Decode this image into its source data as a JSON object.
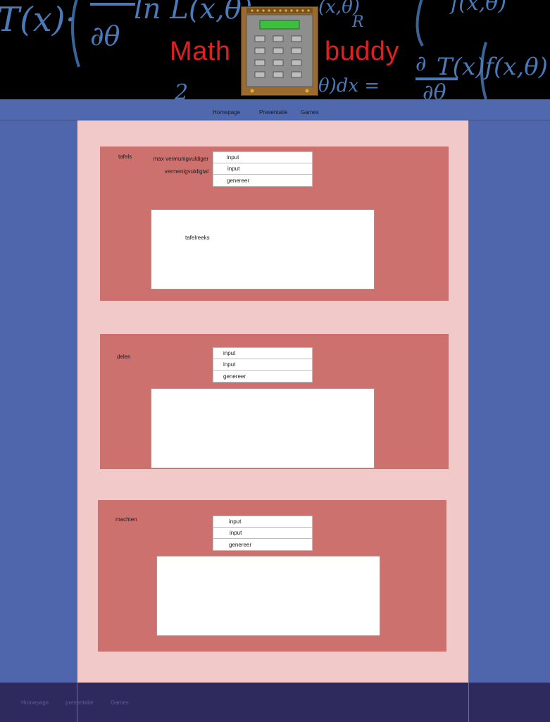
{
  "brand": {
    "word1": "Math",
    "word2": "buddy"
  },
  "nav": {
    "homepage": "Homepage",
    "presentatie": "Presentatie",
    "games": "Games"
  },
  "tafels": {
    "title": "tafels",
    "label_max": "max vermunigvuldiger",
    "label_getal": "vermenigvuldigtal",
    "input1_placeholder": "input",
    "input2_placeholder": "input",
    "button": "genereer",
    "output": "tafelreeks"
  },
  "delen": {
    "title": "delen",
    "input1_placeholder": "input",
    "input2_placeholder": "input",
    "button": "genereer",
    "output": ""
  },
  "machten": {
    "title": "machten",
    "input1_placeholder": "input",
    "input2_placeholder": "input",
    "button": "genereer",
    "output": ""
  },
  "footer": {
    "homepage": "Homepage",
    "presentatie": "presentatie",
    "games": "Games"
  },
  "colors": {
    "page_bg": "#4f66ad",
    "content_bg": "#f2c9c9",
    "card_bg": "#cc716e",
    "footer_bg": "#2f2a5d",
    "brand_red": "#e02020"
  }
}
